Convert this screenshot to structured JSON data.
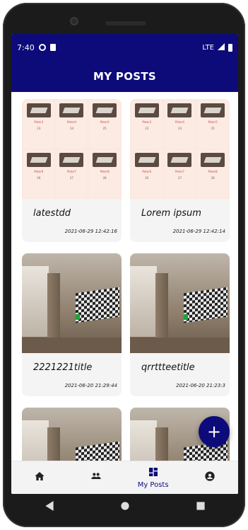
{
  "status_bar": {
    "time": "7:40",
    "network": "LTE"
  },
  "header": {
    "title": "MY POSTS"
  },
  "posts": [
    {
      "title": "latestdd",
      "date": "2021-06-29 12:42:16",
      "thumb": "collage",
      "collage": {
        "names": [
          "Peter3",
          "Peter4",
          "Peter5",
          "Peter6",
          "Peter7",
          "Peter8"
        ],
        "nums": [
          "23",
          "24",
          "25",
          "26",
          "27",
          "28"
        ]
      }
    },
    {
      "title": "Lorem ipsum",
      "date": "2021-06-29 12:42:14",
      "thumb": "collage",
      "collage": {
        "names": [
          "Peter3",
          "Peter4",
          "Peter5",
          "Peter6",
          "Peter7",
          "Peter8"
        ],
        "nums": [
          "23",
          "24",
          "25",
          "26",
          "27",
          "28"
        ]
      }
    },
    {
      "title": "2221221title",
      "date": "2021-06-20 21:29:44",
      "thumb": "room"
    },
    {
      "title": "qrrttteetitle",
      "date": "2021-06-20 21:23:3",
      "thumb": "room"
    },
    {
      "title": "",
      "date": "",
      "thumb": "room"
    },
    {
      "title": "",
      "date": "",
      "thumb": "room"
    }
  ],
  "fab": {
    "icon": "plus-icon",
    "label": "+"
  },
  "bottom_nav": {
    "items": [
      {
        "icon": "home-icon",
        "label": "",
        "active": false
      },
      {
        "icon": "people-icon",
        "label": "",
        "active": false
      },
      {
        "icon": "dashboard-icon",
        "label": "My Posts",
        "active": true
      },
      {
        "icon": "account-icon",
        "label": "",
        "active": false
      }
    ]
  },
  "colors": {
    "primary": "#0d0b7a"
  }
}
